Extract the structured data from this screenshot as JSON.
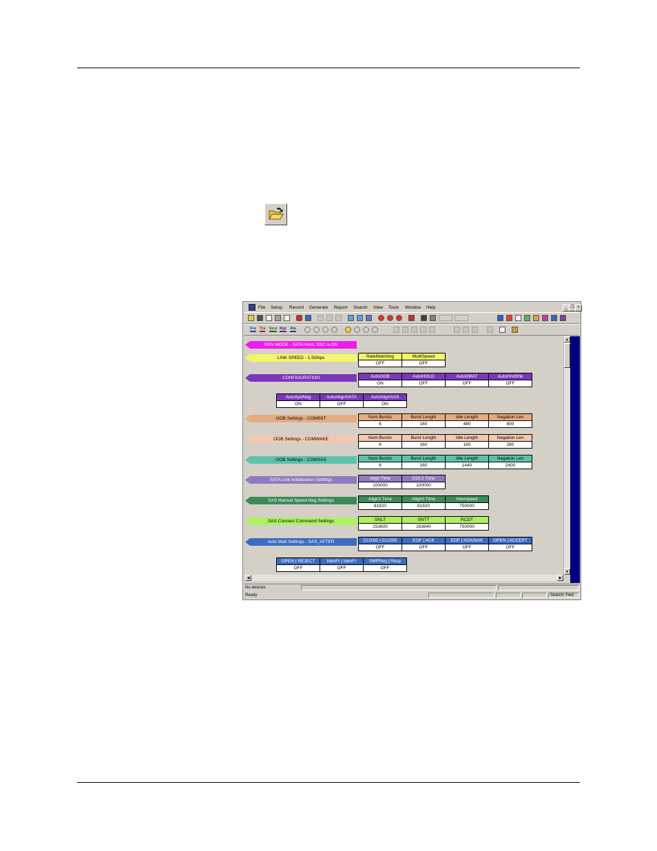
{
  "window": {
    "menu": [
      "File",
      "Setup",
      "Record",
      "Generate",
      "Report",
      "Search",
      "View",
      "Tools",
      "Window",
      "Help"
    ],
    "mdi_buttons": [
      "_",
      "❐",
      "×"
    ],
    "tabs": [
      "Fra",
      "Tra",
      "Scsi",
      "Mgt",
      "Ata"
    ]
  },
  "rows": [
    {
      "label": "GEN MODE - SATA Host, SSC is ON",
      "tag_bg": "#f019f0",
      "tag_fg": "#ffffff",
      "head_bg": "",
      "head_fg": "",
      "tables": []
    },
    {
      "label": "LINK SPEED  -  1.5Gbps",
      "tag_bg": "#f5f56a",
      "tag_fg": "#000000",
      "head_bg": "#f5f56a",
      "head_fg": "#000000",
      "tables": [
        {
          "headers": [
            "RateMatching",
            "MultiSpeed"
          ],
          "values": [
            "OFF",
            "OFF"
          ]
        }
      ]
    },
    {
      "label": "CONFIGURATION",
      "tag_bg": "#7a38b8",
      "tag_fg": "#ffffff",
      "head_bg": "#7a38b8",
      "head_fg": "#ffffff",
      "tables": [
        {
          "headers": [
            "AutoOOB",
            "AutoHOLD",
            "AutoDMAT",
            "AutoHndShk"
          ],
          "values": [
            "ON",
            "OFF",
            "OFF",
            "OFF"
          ]
        },
        {
          "headers": [
            "AutoSpdNeg",
            "AutoAlignSATA",
            "AutoAlignSAS"
          ],
          "values": [
            "ON",
            "OFF",
            "ON"
          ]
        }
      ]
    },
    {
      "label": "OOB Settings - COMINIT",
      "tag_bg": "#e8aa80",
      "tag_fg": "#000000",
      "head_bg": "#e8aa80",
      "head_fg": "#000000",
      "tables": [
        {
          "headers": [
            "Num Bursts",
            "Burst Length",
            "Idle Length",
            "Negation Len"
          ],
          "values": [
            "6",
            "160",
            "480",
            "800"
          ]
        }
      ]
    },
    {
      "label": "OOB Settings - COMWAKE",
      "tag_bg": "#f2c8b0",
      "tag_fg": "#000000",
      "head_bg": "#f2c8b0",
      "head_fg": "#000000",
      "tables": [
        {
          "headers": [
            "Num Bursts",
            "Burst Length",
            "Idle Length",
            "Negation Len"
          ],
          "values": [
            "6",
            "160",
            "160",
            "280"
          ]
        }
      ]
    },
    {
      "label": "OOB Settings - COMSAS",
      "tag_bg": "#5cc2aa",
      "tag_fg": "#000000",
      "head_bg": "#5cc2aa",
      "head_fg": "#000000",
      "tables": [
        {
          "headers": [
            "Num Bursts",
            "Burst Length",
            "Idle Length",
            "Negation Len"
          ],
          "values": [
            "6",
            "160",
            "1440",
            "2400"
          ]
        }
      ]
    },
    {
      "label": "SATA Link Initialization Settings",
      "tag_bg": "#9278c0",
      "tag_fg": "#ffffff",
      "head_bg": "#9278c0",
      "head_fg": "#ffffff",
      "tables": [
        {
          "headers": [
            "Align Time",
            "D10.2 Time"
          ],
          "values": [
            "100000",
            "100000"
          ]
        }
      ]
    },
    {
      "label": "SAS Manual Speed Neg Settings",
      "tag_bg": "#3a8a58",
      "tag_fg": "#ffffff",
      "head_bg": "#3a8a58",
      "head_fg": "#ffffff",
      "tables": [
        {
          "headers": [
            "Align1 Time",
            "Align0 Time",
            "Interspeed"
          ],
          "values": [
            "81920",
            "81920",
            "750000"
          ]
        }
      ]
    },
    {
      "label": "SAS Connect Command Settings",
      "tag_bg": "#aef060",
      "tag_fg": "#000000",
      "head_bg": "#aef060",
      "head_fg": "#000000",
      "tables": [
        {
          "headers": [
            "SNLT",
            "SNTT",
            "RCDT"
          ],
          "values": [
            "153600",
            "163840",
            "750000"
          ]
        }
      ]
    },
    {
      "label": "Auto Wait Settings - SAS_AFTER",
      "tag_bg": "#3c6cc0",
      "tag_fg": "#ffffff",
      "head_bg": "#3c6cc0",
      "head_fg": "#ffffff",
      "tables": [
        {
          "headers": [
            "CLOSE | CLOSE",
            "EOF | ACK",
            "EOF | ACK/NAK",
            "OPEN | ACCEPT"
          ],
          "values": [
            "OFF",
            "OFF",
            "OFF",
            "OFF"
          ]
        },
        {
          "headers": [
            "OPEN | REJECT",
            "IdenFr | IdenFr",
            "SMPReq | Resp"
          ],
          "values": [
            "OFF",
            "OFF",
            "OFF"
          ]
        }
      ]
    }
  ],
  "status": {
    "line1": "No devices",
    "line2": "Ready",
    "search": "Search: Fwd"
  }
}
